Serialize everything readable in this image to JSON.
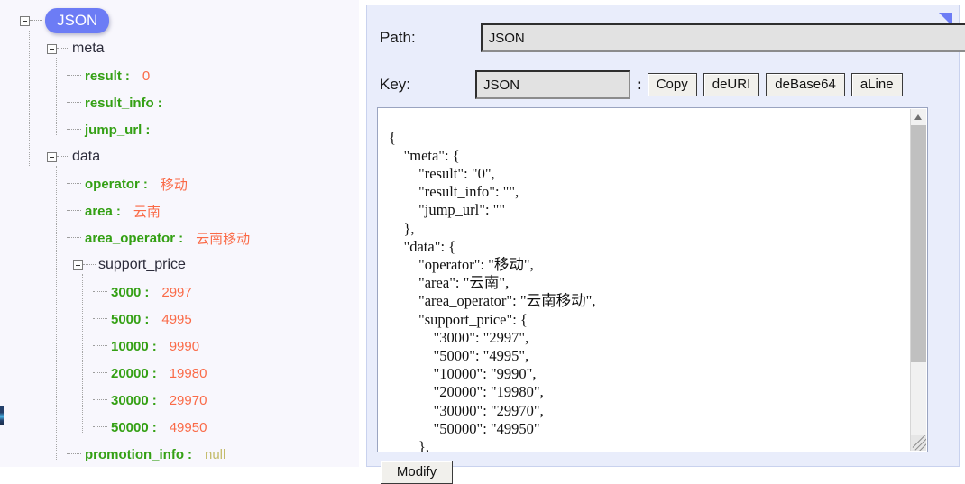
{
  "tree": {
    "root_badge": "JSON",
    "nodes": [
      {
        "label": "meta",
        "type": "object",
        "indent": 1
      },
      {
        "label": "result",
        "type": "leaf",
        "indent": 2,
        "value": "0",
        "value_kind": "number"
      },
      {
        "label": "result_info",
        "type": "leaf",
        "indent": 2,
        "value": "",
        "value_kind": "string"
      },
      {
        "label": "jump_url",
        "type": "leaf",
        "indent": 2,
        "value": "",
        "value_kind": "string"
      },
      {
        "label": "data",
        "type": "object",
        "indent": 1
      },
      {
        "label": "operator",
        "type": "leaf",
        "indent": 2,
        "value": "移动",
        "value_kind": "string"
      },
      {
        "label": "area",
        "type": "leaf",
        "indent": 2,
        "value": "云南",
        "value_kind": "string"
      },
      {
        "label": "area_operator",
        "type": "leaf",
        "indent": 2,
        "value": "云南移动",
        "value_kind": "string"
      },
      {
        "label": "support_price",
        "type": "object",
        "indent": 2
      },
      {
        "label": "3000",
        "type": "leaf",
        "indent": 3,
        "value": "2997",
        "value_kind": "string"
      },
      {
        "label": "5000",
        "type": "leaf",
        "indent": 3,
        "value": "4995",
        "value_kind": "string"
      },
      {
        "label": "10000",
        "type": "leaf",
        "indent": 3,
        "value": "9990",
        "value_kind": "string"
      },
      {
        "label": "20000",
        "type": "leaf",
        "indent": 3,
        "value": "19980",
        "value_kind": "string"
      },
      {
        "label": "30000",
        "type": "leaf",
        "indent": 3,
        "value": "29970",
        "value_kind": "string"
      },
      {
        "label": "50000",
        "type": "leaf",
        "indent": 3,
        "value": "49950",
        "value_kind": "string"
      },
      {
        "label": "promotion_info",
        "type": "leaf",
        "indent": 2,
        "value": "null",
        "value_kind": "null"
      }
    ]
  },
  "panel": {
    "path_label": "Path:",
    "path_value": "JSON",
    "key_label": "Key:",
    "key_value": "JSON",
    "separator": ":",
    "buttons": [
      {
        "label": "Copy"
      },
      {
        "label": "deURI"
      },
      {
        "label": "deBase64"
      },
      {
        "label": "aLine"
      }
    ],
    "modify_button": "Modify",
    "code": "{\n    \"meta\": {\n        \"result\": \"0\",\n        \"result_info\": \"\",\n        \"jump_url\": \"\"\n    },\n    \"data\": {\n        \"operator\": \"移动\",\n        \"area\": \"云南\",\n        \"area_operator\": \"云南移动\",\n        \"support_price\": {\n            \"3000\": \"2997\",\n            \"5000\": \"4995\",\n            \"10000\": \"9990\",\n            \"20000\": \"19980\",\n            \"30000\": \"29970\",\n            \"50000\": \"49950\"\n        },\n        \"promotion_info\": \"\""
  },
  "colors": {
    "badge": "#6c7cf5",
    "key_green": "#34a014",
    "value_orange": "#fa6a47",
    "value_null": "#c3bb6a",
    "panel_bg": "#e9edfb",
    "tree_bg": "#f8f7fd"
  }
}
